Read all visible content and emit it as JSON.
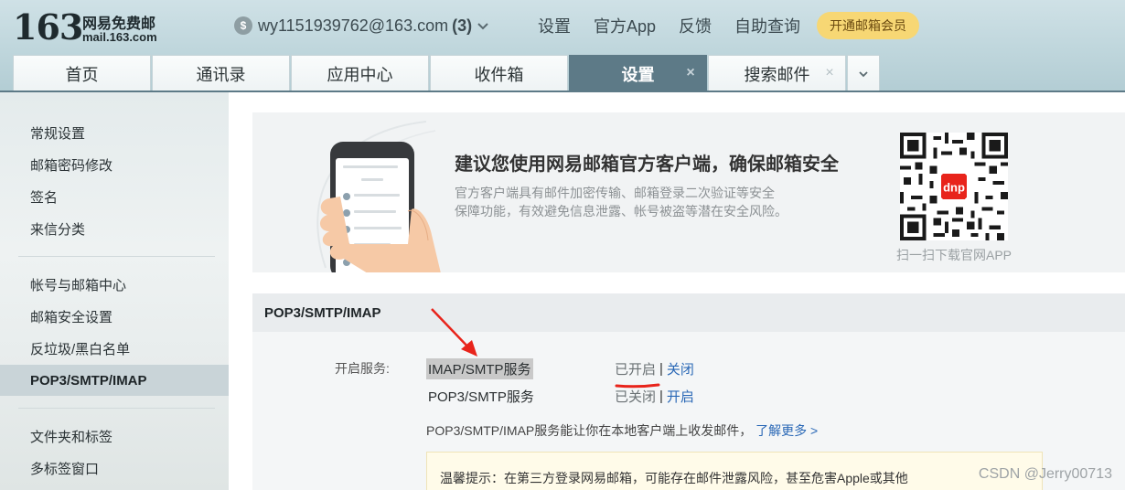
{
  "header": {
    "logo_number": "163",
    "logo_cn": "网易免费邮",
    "logo_domain": "mail.163.com",
    "account_email": "wy1151939762@163.com",
    "account_count": "(3)",
    "links": [
      "设置",
      "官方App",
      "反馈",
      "自助查询"
    ],
    "vip_button": "开通邮箱会员"
  },
  "tabs": [
    {
      "label": "首页",
      "active": false,
      "closable": false
    },
    {
      "label": "通讯录",
      "active": false,
      "closable": false
    },
    {
      "label": "应用中心",
      "active": false,
      "closable": false
    },
    {
      "label": "收件箱",
      "active": false,
      "closable": false
    },
    {
      "label": "设置",
      "active": true,
      "closable": true
    },
    {
      "label": "搜索邮件",
      "active": false,
      "closable": true
    }
  ],
  "sidebar": {
    "groups": [
      [
        "常规设置",
        "邮箱密码修改",
        "签名",
        "来信分类"
      ],
      [
        "帐号与邮箱中心",
        "邮箱安全设置",
        "反垃圾/黑白名单",
        "POP3/SMTP/IMAP"
      ],
      [
        "文件夹和标签",
        "多标签窗口"
      ]
    ],
    "active_item": "POP3/SMTP/IMAP"
  },
  "banner": {
    "title": "建议您使用网易邮箱官方客户端，确保邮箱安全",
    "desc_line1": "官方客户端具有邮件加密传输、邮箱登录二次验证等安全",
    "desc_line2": "保障功能，有效避免信息泄露、帐号被盗等潜在安全风险。",
    "qr_caption": "扫一扫下载官网APP"
  },
  "section": {
    "title": "POP3/SMTP/IMAP",
    "services_label": "开启服务:",
    "services": [
      {
        "name": "IMAP/SMTP服务",
        "status": "已开启",
        "separator": "|",
        "action": "关闭"
      },
      {
        "name": "POP3/SMTP服务",
        "status": "已关闭",
        "separator": "|",
        "action": "开启"
      }
    ],
    "info_text": "POP3/SMTP/IMAP服务能让你在本地客户端上收发邮件，",
    "learn_more": "了解更多 >",
    "tip": "温馨提示：在第三方登录网易邮箱，可能存在邮件泄露风险，甚至危害Apple或其他"
  },
  "watermark": "CSDN @Jerry00713",
  "colors": {
    "header_bg": "#bfd6dc",
    "active_tab": "#5d7a87",
    "link": "#2a68b6",
    "vip": "#f7d774",
    "annotation_red": "#e8241b"
  }
}
